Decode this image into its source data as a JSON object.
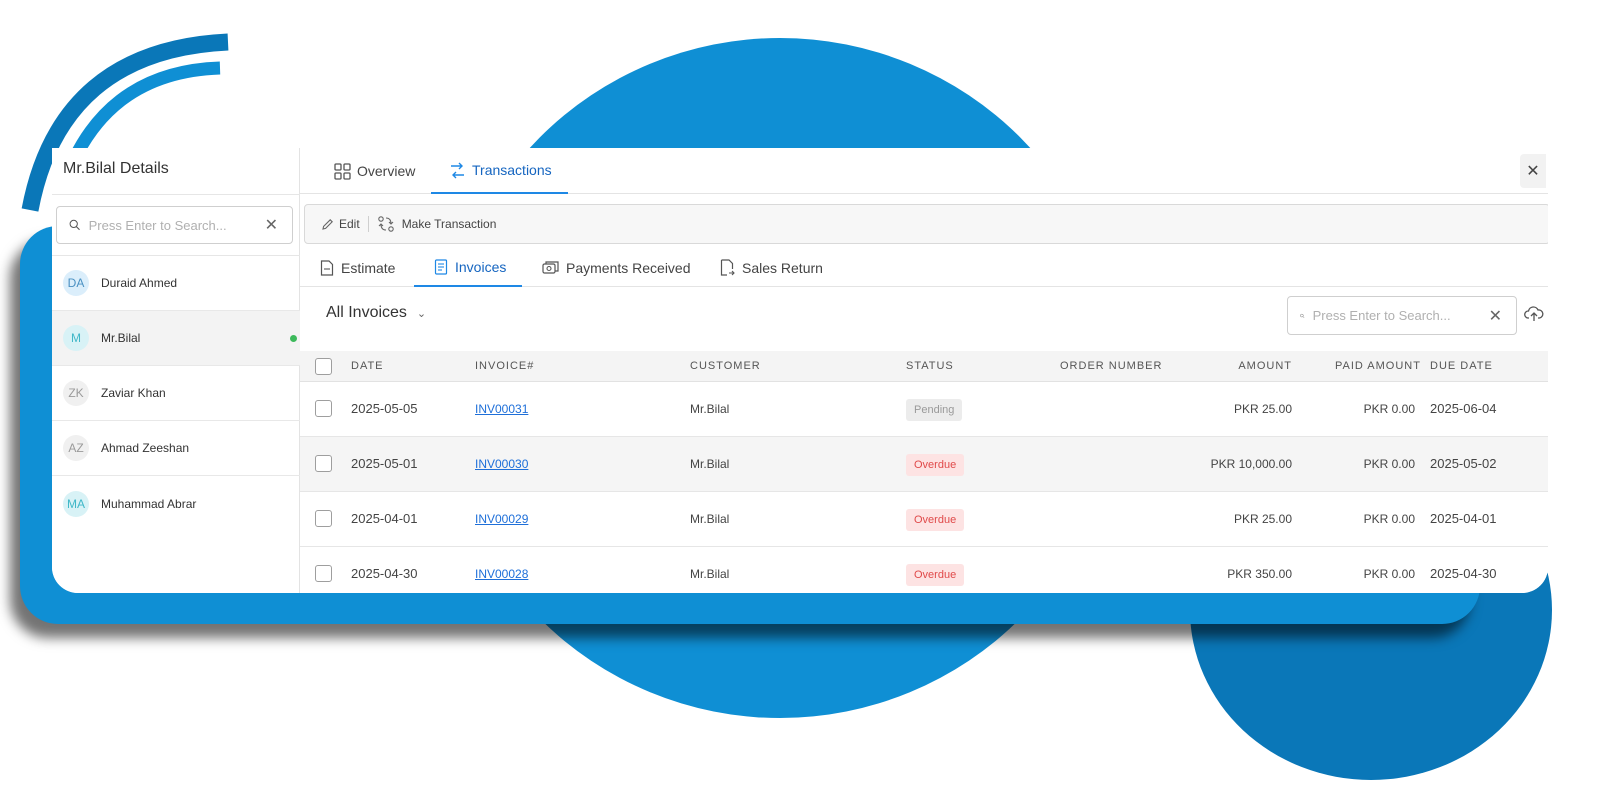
{
  "customer_panel": {
    "title": "Mr.Bilal Details",
    "search": {
      "placeholder": "Press Enter to Search..."
    },
    "customers": [
      {
        "initials": "DA",
        "name": "Duraid Ahmed",
        "avatar_bg": "#dbeefb",
        "avatar_fg": "#4a90c2",
        "active": false,
        "online": false
      },
      {
        "initials": "M",
        "name": "Mr.Bilal",
        "avatar_bg": "#d8f2f6",
        "avatar_fg": "#3fb7c8",
        "active": true,
        "online": true
      },
      {
        "initials": "ZK",
        "name": "Zaviar Khan",
        "avatar_bg": "#f0f0f0",
        "avatar_fg": "#9a9a9a",
        "active": false,
        "online": false
      },
      {
        "initials": "AZ",
        "name": "Ahmad Zeeshan",
        "avatar_bg": "#f0f0f0",
        "avatar_fg": "#9a9a9a",
        "active": false,
        "online": false
      },
      {
        "initials": "MA",
        "name": "Muhammad Abrar",
        "avatar_bg": "#d8f2f6",
        "avatar_fg": "#3fb7c8",
        "active": false,
        "online": false
      }
    ]
  },
  "main_tabs": [
    {
      "label": "Overview",
      "icon": "grid-icon",
      "active": false
    },
    {
      "label": "Transactions",
      "icon": "transfer-icon",
      "active": true
    }
  ],
  "toolbar": {
    "edit_label": "Edit",
    "make_transaction_label": "Make Transaction"
  },
  "sub_tabs": [
    {
      "label": "Estimate",
      "icon": "document-icon",
      "active": false
    },
    {
      "label": "Invoices",
      "icon": "receipt-icon",
      "active": true
    },
    {
      "label": "Payments Received",
      "icon": "cash-icon",
      "active": false
    },
    {
      "label": "Sales Return",
      "icon": "return-document-icon",
      "active": false
    }
  ],
  "invoices": {
    "filter_label": "All Invoices",
    "search": {
      "placeholder": "Press Enter to Search..."
    },
    "columns": [
      "DATE",
      "INVOICE#",
      "CUSTOMER",
      "STATUS",
      "ORDER NUMBER",
      "AMOUNT",
      "PAID AMOUNT",
      "DUE DATE"
    ],
    "rows": [
      {
        "date": "2025-05-05",
        "invoice": "INV00031",
        "customer": "Mr.Bilal",
        "status": "Pending",
        "order_number": "",
        "amount": "PKR 25.00",
        "paid_amount": "PKR 0.00",
        "due_date": "2025-06-04"
      },
      {
        "date": "2025-05-01",
        "invoice": "INV00030",
        "customer": "Mr.Bilal",
        "status": "Overdue",
        "order_number": "",
        "amount": "PKR 10,000.00",
        "paid_amount": "PKR 0.00",
        "due_date": "2025-05-02"
      },
      {
        "date": "2025-04-01",
        "invoice": "INV00029",
        "customer": "Mr.Bilal",
        "status": "Overdue",
        "order_number": "",
        "amount": "PKR 25.00",
        "paid_amount": "PKR 0.00",
        "due_date": "2025-04-01"
      },
      {
        "date": "2025-04-30",
        "invoice": "INV00028",
        "customer": "Mr.Bilal",
        "status": "Overdue",
        "order_number": "",
        "amount": "PKR 350.00",
        "paid_amount": "PKR 0.00",
        "due_date": "2025-04-30"
      }
    ]
  },
  "colors": {
    "accent": "#1e88e5",
    "brand_blue": "#0f8fd4",
    "brand_dark_blue": "#0a77b8",
    "online": "#3cb95b",
    "overdue": "#e04a4a"
  }
}
